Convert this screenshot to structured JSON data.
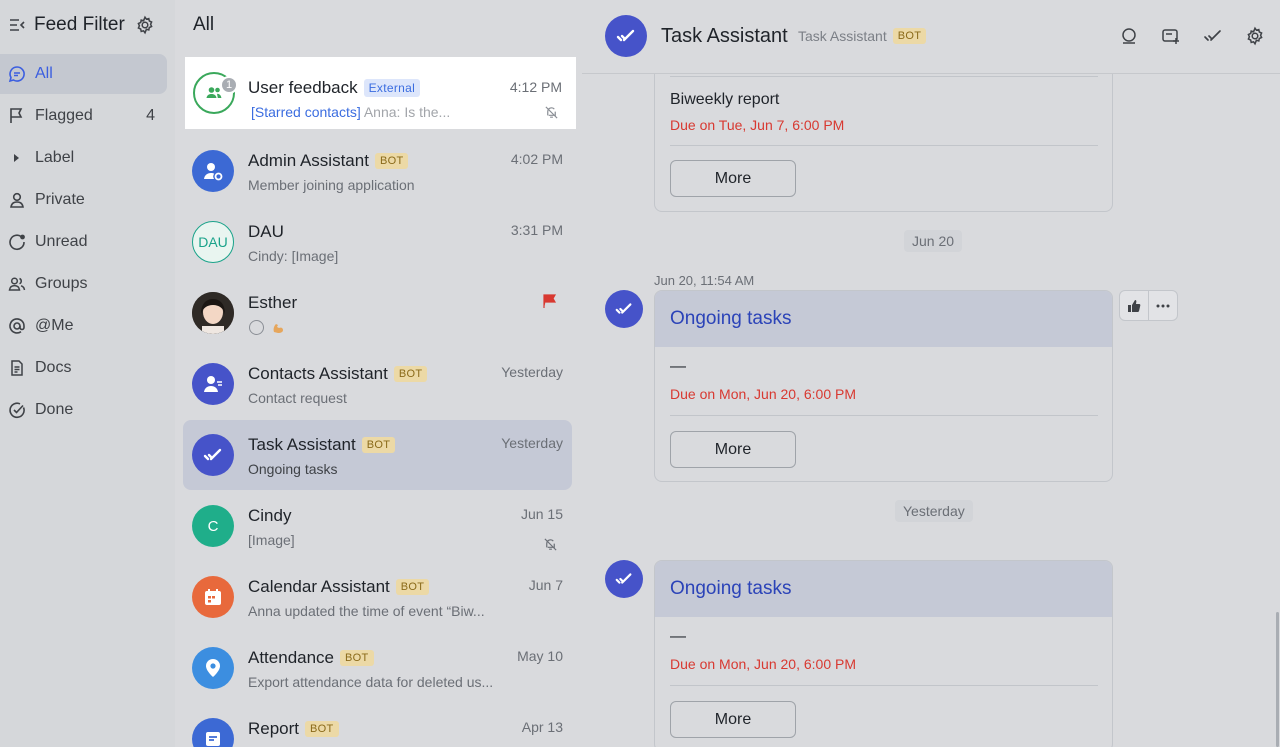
{
  "sidebar": {
    "title": "Feed Filter",
    "items": [
      {
        "label": "All",
        "icon": "chat-bubble-icon",
        "count": ""
      },
      {
        "label": "Flagged",
        "icon": "flag-icon",
        "count": "4"
      },
      {
        "label": "Label",
        "icon": "caret-right-icon",
        "count": ""
      },
      {
        "label": "Private",
        "icon": "person-icon",
        "count": ""
      },
      {
        "label": "Unread",
        "icon": "unread-icon",
        "count": ""
      },
      {
        "label": "Groups",
        "icon": "groups-icon",
        "count": ""
      },
      {
        "label": "@Me",
        "icon": "at-icon",
        "count": ""
      },
      {
        "label": "Docs",
        "icon": "docs-icon",
        "count": ""
      },
      {
        "label": "Done",
        "icon": "check-circle-icon",
        "count": ""
      }
    ]
  },
  "feed": {
    "title": "All",
    "rows": [
      {
        "name": "User feedback",
        "tag": "External",
        "time": "4:12 PM",
        "preview_link": "[Starred contacts]",
        "preview": "Anna: Is the...",
        "badge": "1"
      },
      {
        "name": "Admin Assistant",
        "tag": "BOT",
        "time": "4:02 PM",
        "preview": "Member joining application"
      },
      {
        "name": "DAU",
        "avatar_text": "DAU",
        "time": "3:31 PM",
        "preview": "Cindy: [Image]"
      },
      {
        "name": "Esther",
        "time": "",
        "preview": ""
      },
      {
        "name": "Contacts Assistant",
        "tag": "BOT",
        "time": "Yesterday",
        "preview": "Contact request"
      },
      {
        "name": "Task Assistant",
        "tag": "BOT",
        "time": "Yesterday",
        "preview": "Ongoing tasks"
      },
      {
        "name": "Cindy",
        "avatar_text": "C",
        "time": "Jun 15",
        "preview": "[Image]"
      },
      {
        "name": "Calendar Assistant",
        "tag": "BOT",
        "time": "Jun 7",
        "preview": "Anna updated the time of event “Biw..."
      },
      {
        "name": "Attendance",
        "tag": "BOT",
        "time": "May 10",
        "preview": "Export attendance data for deleted us..."
      },
      {
        "name": "Report",
        "tag": "BOT",
        "time": "Apr 13",
        "preview": ""
      }
    ]
  },
  "chat": {
    "title": "Task Assistant",
    "subtitle": "Task Assistant",
    "tag": "BOT",
    "cards": [
      {
        "title": "",
        "line1": "Biweekly report",
        "due": "Due on Tue, Jun 7, 6:00 PM",
        "more": "More"
      },
      {
        "title": "Ongoing tasks",
        "line1": "—",
        "due": "Due on Mon, Jun 20, 6:00 PM",
        "more": "More"
      },
      {
        "title": "Ongoing tasks",
        "line1": "—",
        "due": "Due on Mon, Jun 20, 6:00 PM",
        "more": "More"
      }
    ],
    "date_chip_1": "Jun 20",
    "date_chip_2": "Yesterday",
    "msg_meta": "Jun 20, 11:54 AM"
  },
  "colors": {
    "accent": "#3b5ee0",
    "bot_avatar": "#4653c9",
    "due_red": "#d83931",
    "card_head": "#c5c9d6"
  }
}
